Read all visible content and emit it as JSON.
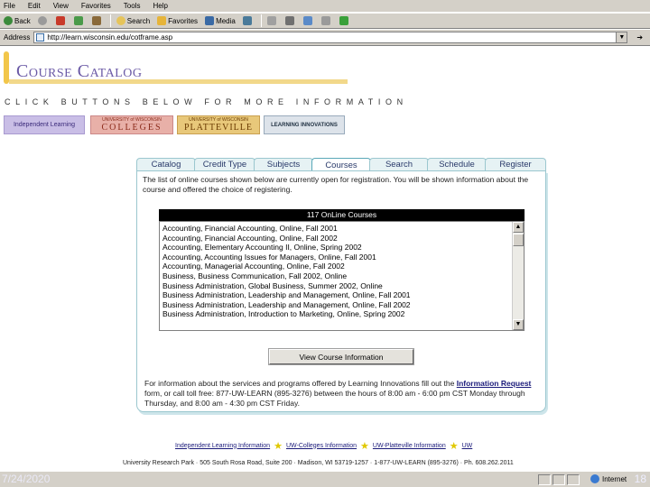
{
  "browser": {
    "menu": [
      "File",
      "Edit",
      "View",
      "Favorites",
      "Tools",
      "Help"
    ],
    "toolbar": {
      "back": "Back",
      "search": "Search",
      "favorites": "Favorites",
      "media": "Media"
    },
    "address_label": "Address",
    "url": "http://learn.wisconsin.edu/cotframe.asp"
  },
  "header": {
    "title": "Course Catalog",
    "subtitle": "CLICK BUTTONS BELOW FOR MORE INFORMATION"
  },
  "partners": {
    "independent": "Independent Learning",
    "uwc_small": "UNIVERSITY of WISCONSIN",
    "uwc_big": "COLLEGES",
    "plat_small": "UNIVERSITY of WISCONSIN",
    "plat_big": "PLATTEVILLE",
    "li": "LEARNING INNOVATIONS"
  },
  "tabs": [
    "Catalog",
    "Credit Type",
    "Subjects",
    "Courses",
    "Search",
    "Schedule",
    "Register"
  ],
  "active_tab": "Courses",
  "panel": {
    "intro": "The list of online courses shown below are currently open for registration. You will be shown information about the course and offered the choice of registering.",
    "courses_header": "117 OnLine Courses",
    "courses": [
      "Accounting, Financial Accounting, Online, Fall 2001",
      "Accounting, Financial Accounting, Online, Fall 2002",
      "Accounting, Elementary Accounting II, Online, Spring 2002",
      "Accounting, Accounting Issues for Managers, Online, Fall 2001",
      "Accounting, Managerial Accounting, Online, Fall 2002",
      "Business, Business Communication, Fall 2002, Online",
      "Business Administration, Global Business, Summer 2002, Online",
      "Business Administration, Leadership and Management, Online, Fall 2001",
      "Business Administration, Leadership and Management, Online, Fall 2002",
      "Business Administration, Introduction to Marketing, Online, Spring 2002"
    ],
    "view_button": "View Course Information",
    "info_before": "For information about the services and programs offered by Learning Innovations fill out the",
    "info_link": "Information Request",
    "info_after": "form, or call toll free: 877-UW-LEARN (895-3276) between the hours of 8:00 am - 6:00 pm CST Monday through Thursday, and 8:00 am - 4:30 pm CST Friday."
  },
  "footer": {
    "links": [
      "Independent Learning Information",
      "UW-Colleges Information",
      "UW-Platteville Information",
      "UW"
    ],
    "address": "University Research Park · 505 South Rosa Road, Suite 200 · Madison, WI 53719-1257 · 1-877-UW-LEARN (895-3276) · Ph. 608.262.2011"
  },
  "status": {
    "date": "7/24/2020",
    "zone": "Internet",
    "page": "18"
  }
}
